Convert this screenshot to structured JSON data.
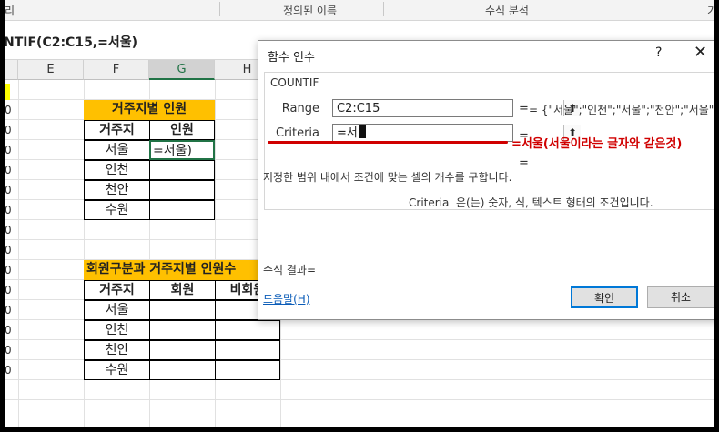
{
  "ribbon": {
    "left_fragment": "리",
    "defined_names": "정의된 이름",
    "formula_audit": "수식 분석",
    "right_fragment": "기"
  },
  "formula_bar": {
    "formula": "NTIF(C2:C15,=서울)"
  },
  "columns": [
    "E",
    "F",
    "G",
    "H"
  ],
  "row_stub": "0",
  "table1": {
    "title": "거주지별 인원",
    "headers": [
      "거주지",
      "인원"
    ],
    "rows": [
      {
        "place": "서울",
        "value": "=서울)"
      },
      {
        "place": "인천",
        "value": ""
      },
      {
        "place": "천안",
        "value": ""
      },
      {
        "place": "수원",
        "value": ""
      }
    ]
  },
  "table2": {
    "title": "회원구분과 거주지별 인원수",
    "headers": [
      "거주지",
      "회원",
      "비회원"
    ],
    "rows": [
      {
        "place": "서울"
      },
      {
        "place": "인천"
      },
      {
        "place": "천안"
      },
      {
        "place": "수원"
      }
    ]
  },
  "dialog": {
    "title": "함수 인수",
    "help_symbol": "?",
    "close_symbol": "✕",
    "function_name": "COUNTIF",
    "range_label": "Range",
    "range_value": "C2:C15",
    "range_preview": "= {\"서울\";\"인천\";\"서울\";\"천안\";\"서울\";\"수",
    "criteria_label": "Criteria",
    "criteria_value": "=서",
    "criteria_preview": "=",
    "annotation": "=서울(서울이라는 글자와 같은것)",
    "result_eq": "=",
    "description": "지정한 범위 내에서 조건에 맞는 셀의 개수를 구합니다.",
    "arg_description_name": "Criteria",
    "arg_description": "은(는) 숫자, 식, 텍스트 형태의 조건입니다.",
    "result_label": "수식 결과=",
    "help_link": "도움말(H)",
    "ok": "확인",
    "cancel": "취소"
  },
  "colors": {
    "title_fill": "#ffc000",
    "annotation": "#d00000",
    "active_cell": "#217346"
  }
}
